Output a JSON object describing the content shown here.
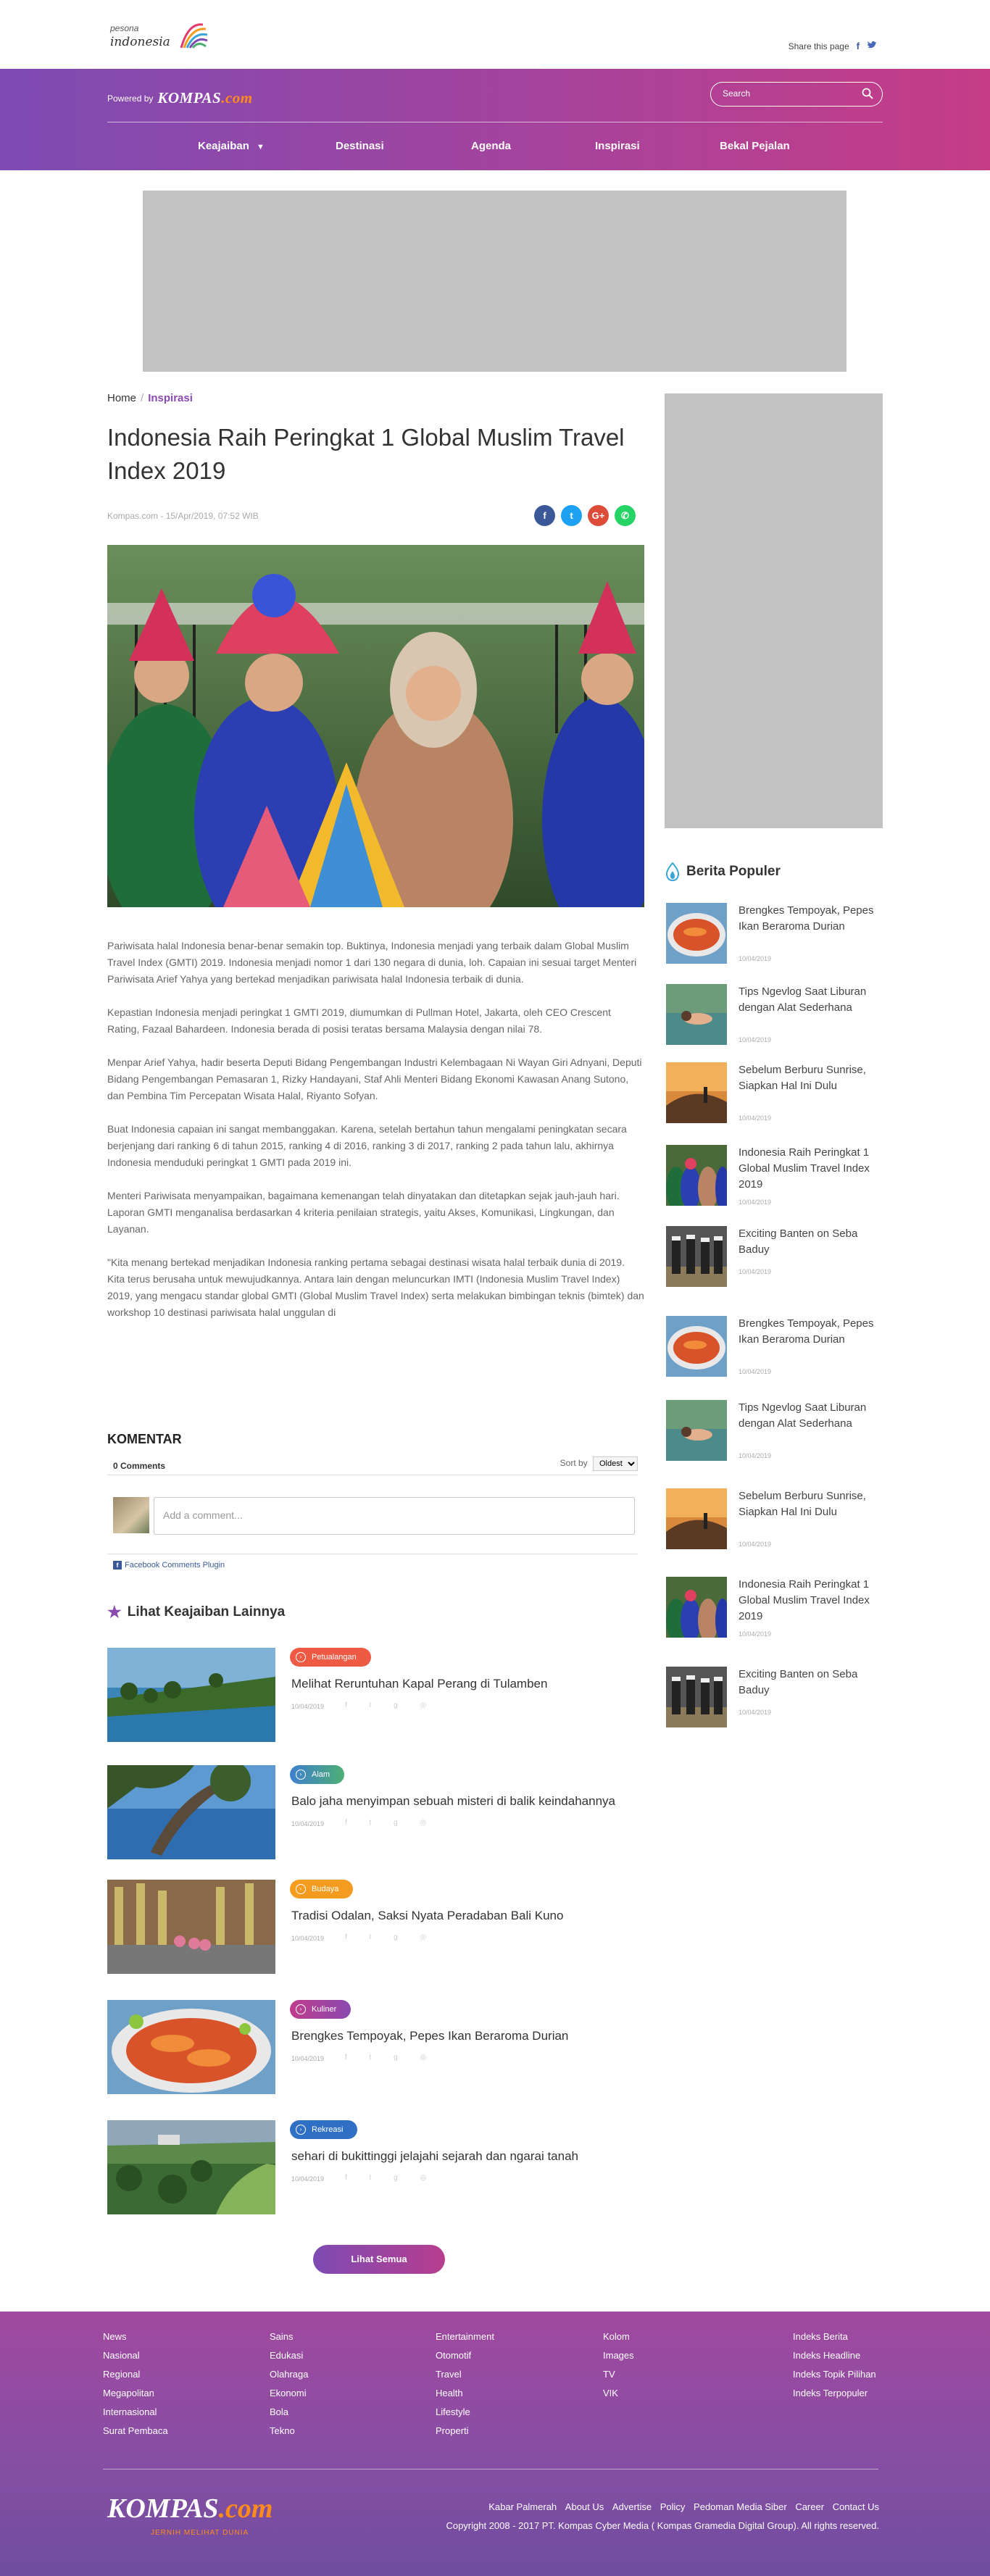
{
  "header": {
    "logo_small": "pesona",
    "logo_main": "indonesia",
    "share_label": "Share this page",
    "share_icons": [
      "facebook-icon",
      "twitter-icon"
    ]
  },
  "band": {
    "powered_label": "Powered by",
    "powered_brand": "KOMPAS",
    "powered_brand_suffix": ".com",
    "search_placeholder": "Search",
    "nav": [
      {
        "label": "Keajaiban",
        "has_dropdown": true
      },
      {
        "label": "Destinasi"
      },
      {
        "label": "Agenda"
      },
      {
        "label": "Inspirasi"
      },
      {
        "label": "Bekal Pejalan"
      }
    ],
    "colors": {
      "start": "#7d4bb3",
      "mid": "#a2449f",
      "end": "#c63c86"
    }
  },
  "breadcrumb": {
    "home": "Home",
    "sep": "/",
    "current": "Inspirasi"
  },
  "article": {
    "title": "Indonesia Raih Peringkat 1 Global Muslim Travel Index 2019",
    "meta": "Kompas.com - 15/Apr/2019, 07:52 WIB",
    "share": [
      {
        "icon": "facebook-icon",
        "glyph": "f",
        "color": "#3b5998"
      },
      {
        "icon": "twitter-icon",
        "glyph": "t",
        "color": "#1da1f2"
      },
      {
        "icon": "google-plus-icon",
        "glyph": "G+",
        "color": "#dd4b39"
      },
      {
        "icon": "whatsapp-icon",
        "glyph": "✆",
        "color": "#25d366"
      }
    ],
    "paragraphs": [
      "Pariwisata halal Indonesia benar-benar semakin top. Buktinya, Indonesia menjadi yang terbaik dalam Global Muslim Travel Index (GMTI) 2019. Indonesia menjadi nomor 1 dari 130 negara di dunia, loh. Capaian ini sesuai target Menteri Pariwisata Arief Yahya yang bertekad menjadikan pariwisata halal Indonesia terbaik di dunia.",
      "Kepastian Indonesia menjadi peringkat 1 GMTI 2019, diumumkan di Pullman Hotel, Jakarta, oleh CEO Crescent Rating, Fazaal Bahardeen. Indonesia berada di posisi teratas bersama Malaysia dengan nilai 78.",
      "Menpar Arief Yahya, hadir beserta Deputi Bidang Pengembangan Industri Kelembagaan Ni Wayan Giri Adnyani, Deputi Bidang Pengembangan Pemasaran 1, Rizky Handayani, Staf Ahli Menteri Bidang Ekonomi Kawasan Anang Sutono, dan Pembina Tim Percepatan Wisata Halal, Riyanto Sofyan.",
      "Buat Indonesia capaian ini sangat membanggakan. Karena, setelah bertahun tahun mengalami peningkatan secara berjenjang dari ranking 6 di tahun 2015, ranking 4 di 2016, ranking 3 di 2017, ranking 2 pada tahun lalu, akhirnya Indonesia menduduki peringkat 1 GMTI pada 2019 ini.",
      "Menteri Pariwisata menyampaikan, bagaimana kemenangan telah dinyatakan dan ditetapkan sejak jauh-jauh hari. Laporan GMTI menganalisa berdasarkan 4 kriteria penilaian strategis, yaitu Akses, Komunikasi, Lingkungan, dan Layanan.",
      "\"Kita menang bertekad menjadikan Indonesia ranking pertama sebagai destinasi wisata halal terbaik dunia di 2019. Kita terus berusaha untuk mewujudkannya. Antara lain dengan meluncurkan IMTI (Indonesia Muslim Travel Index) 2019, yang mengacu standar global GMTI (Global Muslim Travel Index) serta melakukan bimbingan teknis (bimtek) dan workshop  10 destinasi pariwisata halal unggulan di"
    ]
  },
  "comments": {
    "heading": "KOMENTAR",
    "count": "0 Comments",
    "sort_label": "Sort by",
    "sort_value": "Oldest",
    "placeholder": "Add a comment...",
    "plugin": "Facebook Comments Plugin"
  },
  "lihat": {
    "heading": "Lihat Keajaiban Lainnya",
    "items": [
      {
        "tag": "Petualangan",
        "tag_color": "#ef5a44",
        "title": "Melihat Reruntuhan Kapal Perang di Tulamben",
        "date": "10/04/2019"
      },
      {
        "tag": "Alam",
        "tag_color": "#3f7fcf",
        "tag_color2": "#4caf73",
        "title": "Balo jaha menyimpan sebuah misteri di balik keindahannya",
        "date": "10/04/2019"
      },
      {
        "tag": "Budaya",
        "tag_color": "#f39c1f",
        "title": "Tradisi Odalan, Saksi Nyata Peradaban Bali Kuno",
        "date": "10/04/2019"
      },
      {
        "tag": "Kuliner",
        "tag_color": "#c03c8c",
        "tag_color2": "#8a4ab0",
        "title": "Brengkes Tempoyak, Pepes Ikan Beraroma Durian",
        "date": "10/04/2019"
      },
      {
        "tag": "Rekreasi",
        "tag_color": "#2f6fc4",
        "title": "sehari di bukittinggi jelajahi sejarah dan ngarai tanah",
        "date": "10/04/2019"
      }
    ],
    "more_button": "Lihat Semua"
  },
  "populer": {
    "heading": "Berita Populer",
    "items": [
      {
        "title": "Brengkes Tempoyak, Pepes Ikan Beraroma Durian",
        "date": "10/04/2019"
      },
      {
        "title": "Tips Ngevlog Saat Liburan dengan Alat Sederhana",
        "date": "10/04/2019"
      },
      {
        "title": "Sebelum Berburu Sunrise, Siapkan Hal Ini Dulu",
        "date": "10/04/2019"
      },
      {
        "title": "Indonesia Raih Peringkat 1 Global Muslim Travel Index 2019",
        "date": "10/04/2019"
      },
      {
        "title": "Exciting Banten on Seba Baduy",
        "date": "10/04/2019"
      },
      {
        "title": "Brengkes Tempoyak, Pepes Ikan Beraroma Durian",
        "date": "10/04/2019"
      },
      {
        "title": "Tips Ngevlog Saat Liburan dengan Alat Sederhana",
        "date": "10/04/2019"
      },
      {
        "title": "Sebelum Berburu Sunrise, Siapkan Hal Ini Dulu",
        "date": "10/04/2019"
      },
      {
        "title": "Indonesia Raih Peringkat 1 Global Muslim Travel Index 2019",
        "date": "10/04/2019"
      },
      {
        "title": "Exciting Banten on Seba Baduy",
        "date": "10/04/2019"
      }
    ]
  },
  "footer": {
    "col1": [
      "News",
      "Nasional",
      "Regional",
      "Megapolitan",
      "Internasional",
      "Surat Pembaca"
    ],
    "col2": [
      "Sains",
      "Edukasi",
      "Olahraga",
      "Ekonomi",
      "Bola",
      "Tekno"
    ],
    "col3": [
      "Entertainment",
      "Otomotif",
      "Travel",
      "Health",
      "Lifestyle",
      "Properti"
    ],
    "col4": [
      "Kolom",
      "Images",
      "TV",
      "VIK"
    ],
    "col5": [
      "Indeks Berita",
      "Indeks Headline",
      "Indeks Topik Pilihan",
      "Indeks Terpopuler"
    ],
    "logo": "KOMPAS",
    "logo_suffix": ".com",
    "logo_tagline": "JERNIH MELIHAT DUNIA",
    "links": [
      "Kabar Palmerah",
      "About Us",
      "Advertise",
      "Policy",
      "Pedoman Media Siber",
      "Career",
      "Contact Us"
    ],
    "copyright": "Copyright 2008 - 2017 PT. Kompas Cyber Media ( Kompas Gramedia Digital Group). All rights reserved."
  }
}
